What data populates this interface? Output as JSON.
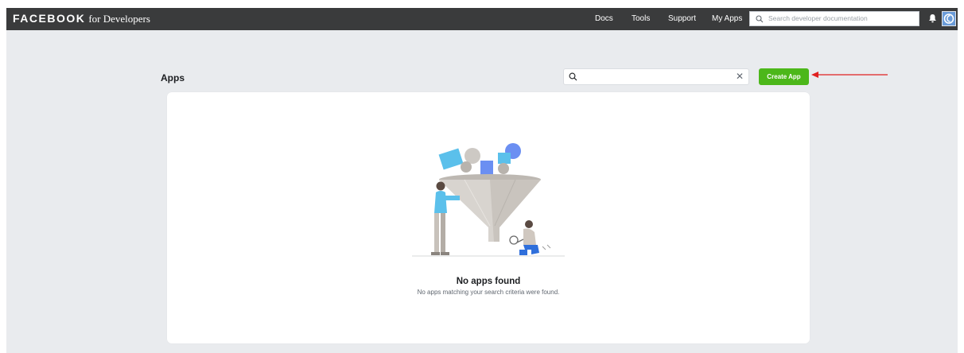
{
  "topbar": {
    "brand_main": "FACEBOOK",
    "brand_sub": "for Developers",
    "nav": [
      "Docs",
      "Tools",
      "Support",
      "My Apps"
    ],
    "search_placeholder": "Search developer documentation"
  },
  "apps": {
    "title": "Apps",
    "search_value": "",
    "create_label": "Create App"
  },
  "empty_state": {
    "title": "No apps found",
    "subtitle": "No apps matching your search criteria were found."
  },
  "colors": {
    "topbar": "#3a3b3c",
    "page_bg": "#e9ebee",
    "create_button": "#4cb71a",
    "annotation_arrow": "#e02020"
  },
  "icons": [
    "search-icon",
    "bell-icon",
    "avatar-icon",
    "clear-icon",
    "funnel-illustration"
  ]
}
